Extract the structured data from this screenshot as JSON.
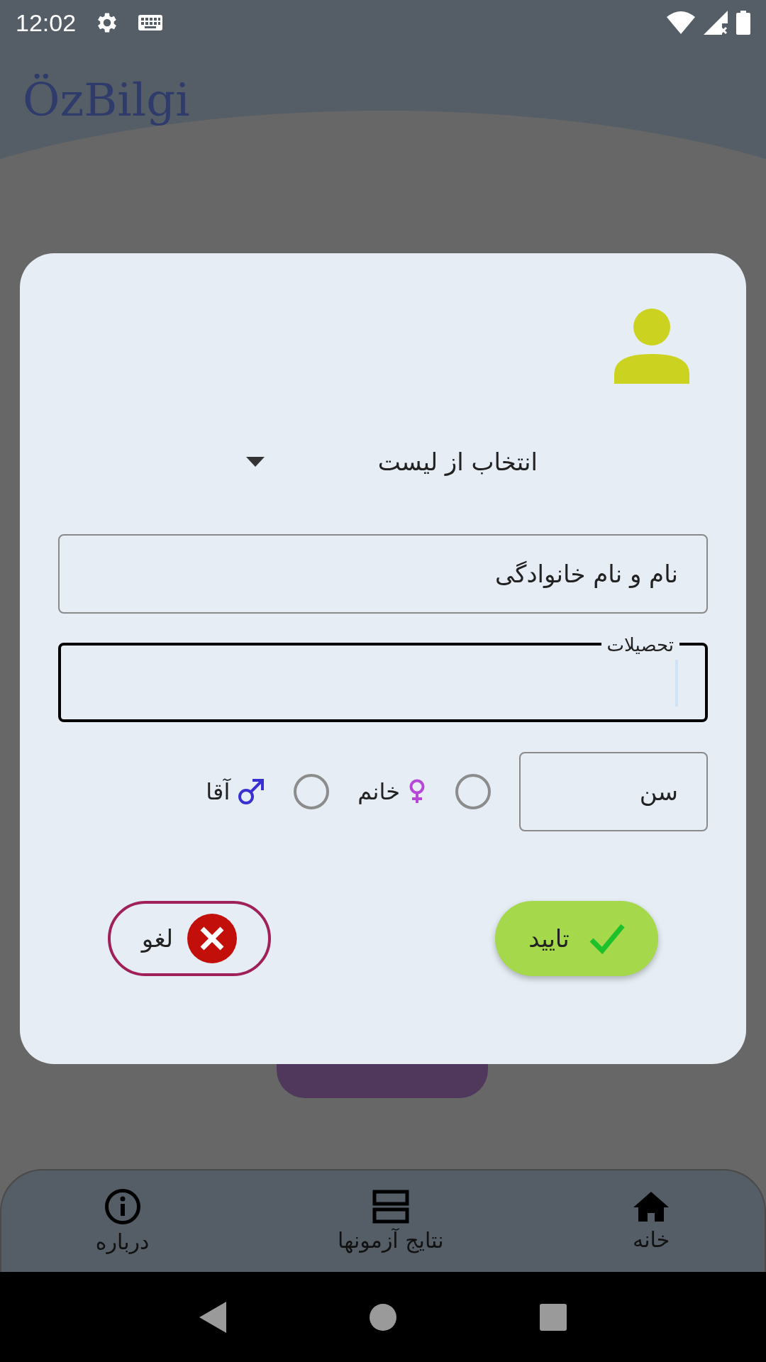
{
  "status_bar": {
    "time": "12:02"
  },
  "app": {
    "logo": "ÖzBilgi"
  },
  "dialog": {
    "dropdown": {
      "label": "انتخاب از لیست"
    },
    "name_field": {
      "placeholder": "نام و نام خانوادگی"
    },
    "education_field": {
      "label": "تحصیلات",
      "focused": true
    },
    "age_field": {
      "placeholder": "سن"
    },
    "gender_options": [
      {
        "kind": "female",
        "label": "خانم",
        "selected": false,
        "color": "#b548d6"
      },
      {
        "kind": "male",
        "label": "آقا",
        "selected": false,
        "color": "#3a2fd0"
      }
    ],
    "buttons": [
      {
        "kind": "confirm",
        "label": "تایید"
      },
      {
        "kind": "cancel",
        "label": "لغو"
      }
    ]
  },
  "bottom_nav": [
    {
      "kind": "home",
      "label": "خانه"
    },
    {
      "kind": "results",
      "label": "نتایج آزمونها"
    },
    {
      "kind": "about",
      "label": "درباره"
    }
  ]
}
